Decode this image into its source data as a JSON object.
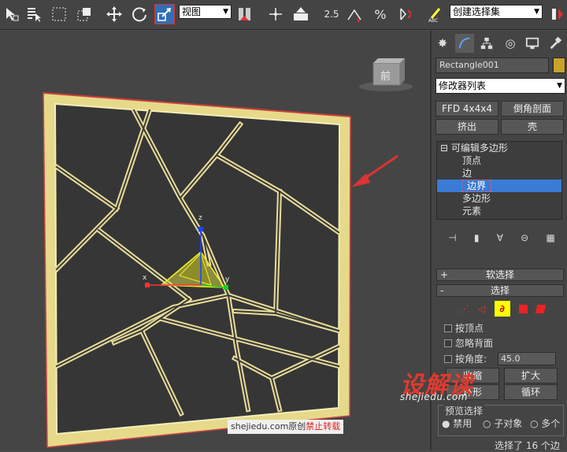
{
  "toolbar": {
    "view_dropdown": "视图",
    "selection_set": "创建选择集",
    "snap_25": "2.5",
    "percent_label": "%"
  },
  "viewport": {
    "viewcube_label": "前",
    "gizmo_x": "x",
    "gizmo_y": "y",
    "gizmo_z": "z"
  },
  "panel": {
    "object_name": "Rectangle001",
    "modifier_list": "修改器列表",
    "buttons": [
      "FFD 4x4x4",
      "倒角剖面",
      "挤出",
      "壳"
    ],
    "stack": {
      "root": "可编辑多边形",
      "items": [
        "顶点",
        "边",
        "边界",
        "多边形",
        "元素"
      ],
      "selected": "边界"
    },
    "soft_select": "软选择",
    "selection": "选择",
    "by_vertex": "按顶点",
    "ignore_backfacing": "忽略背面",
    "by_angle": "按角度:",
    "angle_value": "45.0",
    "shrink": "收缩",
    "grow": "扩大",
    "ring": "环形",
    "loop": "循环",
    "preview_select": "预览选择",
    "preview_opts": [
      "禁用",
      "子对象",
      "多个"
    ],
    "status": "选择了 16 个边"
  },
  "watermark": {
    "logo": "设解读",
    "url": "shejiedu.com",
    "credit": "shejiedu.com原创",
    "credit_red": "禁止转载"
  }
}
